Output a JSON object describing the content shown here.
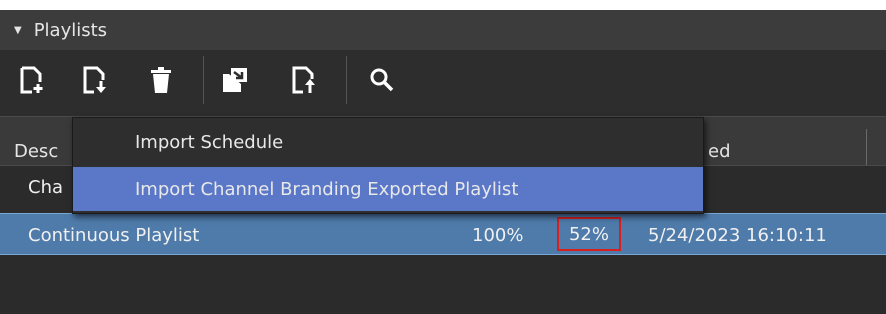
{
  "header": {
    "title": "Playlists",
    "collapse_glyph": "▼"
  },
  "toolbar": {
    "icons": [
      "new-playlist-icon",
      "import-playlist-icon",
      "delete-icon",
      "export-package-icon",
      "export-playlist-icon",
      "search-icon"
    ]
  },
  "columns": {
    "description": "Desc",
    "date": "ed"
  },
  "rows": [
    {
      "description": "Cha"
    },
    {
      "description": "Continuous Playlist",
      "progress_a": "100%",
      "progress_b": "52%",
      "date": "5/24/2023 16:10:11"
    }
  ],
  "menu": {
    "items": [
      {
        "label": "Import Schedule"
      },
      {
        "label": "Import Channel Branding Exported Playlist"
      }
    ]
  },
  "colors": {
    "selected_row": "#4f7bab",
    "menu_highlight": "#5b78c8",
    "highlight_box": "#d81f1f"
  }
}
